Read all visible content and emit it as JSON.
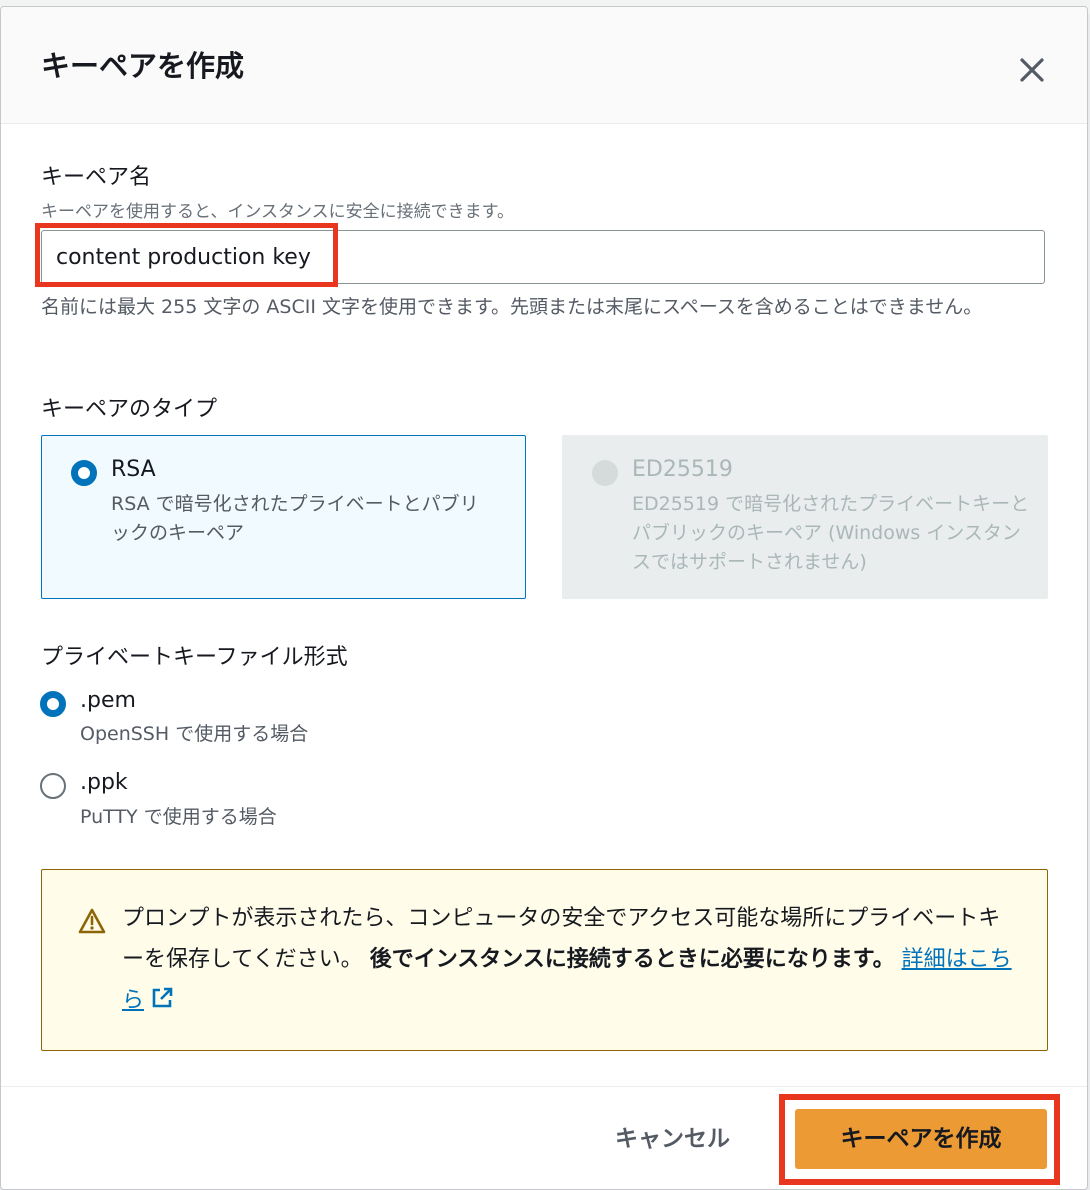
{
  "dialog": {
    "title": "キーペアを作成",
    "close_label": "×"
  },
  "key_pair_name": {
    "label": "キーペア名",
    "description": "キーペアを使用すると、インスタンスに安全に接続できます。",
    "value": "content production key",
    "constraint": "名前には最大 255 文字の ASCII 文字を使用できます。先頭または末尾にスペースを含めることはできません。"
  },
  "key_pair_type": {
    "label": "キーペアのタイプ",
    "options": [
      {
        "title": "RSA",
        "description": "RSA で暗号化されたプライベートとパブリックのキーペア",
        "selected": true,
        "disabled": false
      },
      {
        "title": "ED25519",
        "description": "ED25519 で暗号化されたプライベートキーとパブリックのキーペア (Windows インスタンスではサポートされません)",
        "selected": false,
        "disabled": true
      }
    ]
  },
  "file_format": {
    "label": "プライベートキーファイル形式",
    "options": [
      {
        "title": ".pem",
        "description": "OpenSSH で使用する場合",
        "selected": true
      },
      {
        "title": ".ppk",
        "description": "PuTTY で使用する場合",
        "selected": false
      }
    ]
  },
  "warning": {
    "icon": "warning-triangle-icon",
    "text": "プロンプトが表示されたら、コンピュータの安全でアクセス可能な場所にプライベートキーを保存してください。",
    "strong_text": "後でインスタンスに接続するときに必要になります。",
    "link_text": "詳細はこちら",
    "link_icon": "external-link-icon"
  },
  "footer": {
    "cancel_label": "キャンセル",
    "create_label": "キーペアを作成"
  },
  "colors": {
    "accent": "#0073bb",
    "primary_button": "#ec9a34",
    "highlight": "#e8361f",
    "warning_bg": "#fffce9"
  }
}
